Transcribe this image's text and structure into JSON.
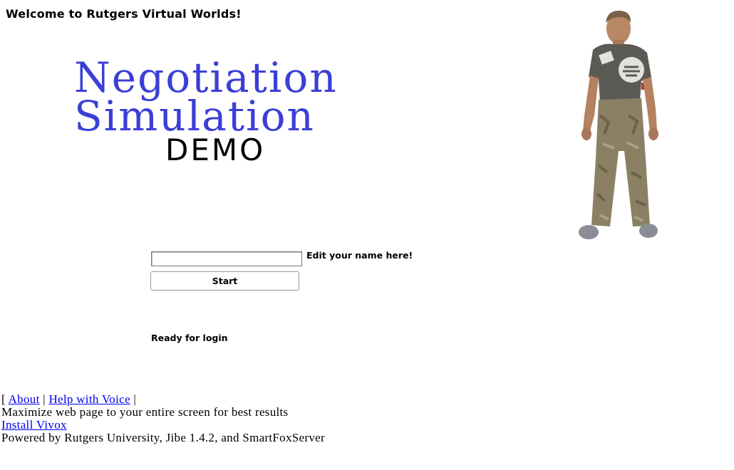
{
  "header": {
    "welcome": "Welcome to Rutgers Virtual Worlds!"
  },
  "logo": {
    "line1": "Negotiation",
    "line2": "Simulation",
    "demo": "DEMO",
    "title_color": "#3b3fd6"
  },
  "avatar": {
    "description_icon": "avatar-figure"
  },
  "login": {
    "name_value": "",
    "name_hint": "Edit your name here!",
    "start_label": "Start",
    "status": "Ready for login"
  },
  "footer": {
    "bracket_open": "[",
    "about_link": "About",
    "divider1": "|",
    "help_link": "Help with Voice",
    "divider2": "|",
    "tip": "Maximize web page to your entire screen for best results",
    "install_link": "Install Vivox",
    "powered_by": "Powered by Rutgers University, Jibe 1.4.2, and SmartFoxServer",
    "link_color": "#0000ee"
  }
}
